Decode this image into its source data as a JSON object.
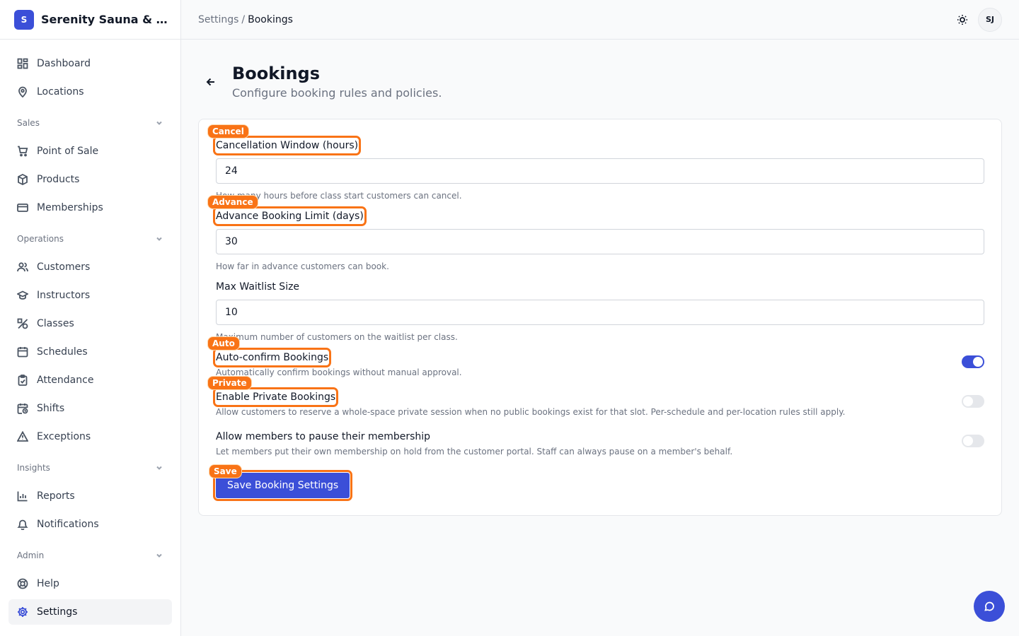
{
  "brand": {
    "logo_letter": "S",
    "name": "Serenity Sauna & Spa"
  },
  "sidebar": {
    "top_items": [
      {
        "label": "Dashboard",
        "icon": "dashboard-icon"
      },
      {
        "label": "Locations",
        "icon": "map-pin-icon"
      }
    ],
    "sections": [
      {
        "title": "Sales",
        "items": [
          {
            "label": "Point of Sale",
            "icon": "cart-icon"
          },
          {
            "label": "Products",
            "icon": "box-icon"
          },
          {
            "label": "Memberships",
            "icon": "credit-card-icon"
          }
        ]
      },
      {
        "title": "Operations",
        "items": [
          {
            "label": "Customers",
            "icon": "users-icon"
          },
          {
            "label": "Instructors",
            "icon": "graduation-cap-icon"
          },
          {
            "label": "Classes",
            "icon": "shapes-icon"
          },
          {
            "label": "Schedules",
            "icon": "calendar-icon"
          },
          {
            "label": "Attendance",
            "icon": "clipboard-check-icon"
          },
          {
            "label": "Shifts",
            "icon": "calendar-clock-icon"
          },
          {
            "label": "Exceptions",
            "icon": "warning-icon"
          }
        ]
      },
      {
        "title": "Insights",
        "items": [
          {
            "label": "Reports",
            "icon": "bar-chart-icon"
          },
          {
            "label": "Notifications",
            "icon": "bell-icon"
          }
        ]
      },
      {
        "title": "Admin",
        "items": [
          {
            "label": "Help",
            "icon": "life-buoy-icon"
          },
          {
            "label": "Settings",
            "icon": "gear-icon",
            "active": true
          }
        ]
      }
    ]
  },
  "topbar": {
    "breadcrumb_parent": "Settings",
    "breadcrumb_separator": "/",
    "breadcrumb_current": "Bookings",
    "avatar_initials": "SJ"
  },
  "page": {
    "title": "Bookings",
    "subtitle": "Configure booking rules and policies."
  },
  "form": {
    "cancellation": {
      "label": "Cancellation Window (hours)",
      "value": "24",
      "help": "How many hours before class start customers can cancel.",
      "tag": "Cancel"
    },
    "advance": {
      "label": "Advance Booking Limit (days)",
      "value": "30",
      "help": "How far in advance customers can book.",
      "tag": "Advance"
    },
    "waitlist": {
      "label": "Max Waitlist Size",
      "value": "10",
      "help": "Maximum number of customers on the waitlist per class."
    },
    "auto_confirm": {
      "label": "Auto-confirm Bookings",
      "desc": "Automatically confirm bookings without manual approval.",
      "enabled": true,
      "tag": "Auto"
    },
    "private": {
      "label": "Enable Private Bookings",
      "desc": "Allow customers to reserve a whole-space private session when no public bookings exist for that slot. Per-schedule and per-location rules still apply.",
      "enabled": false,
      "tag": "Private"
    },
    "pause": {
      "label": "Allow members to pause their membership",
      "desc": "Let members put their own membership on hold from the customer portal. Staff can always pause on a member's behalf.",
      "enabled": false
    },
    "save": {
      "label": "Save Booking Settings",
      "tag": "Save"
    }
  },
  "colors": {
    "accent": "#3b4fd8",
    "highlight": "#f97316"
  }
}
